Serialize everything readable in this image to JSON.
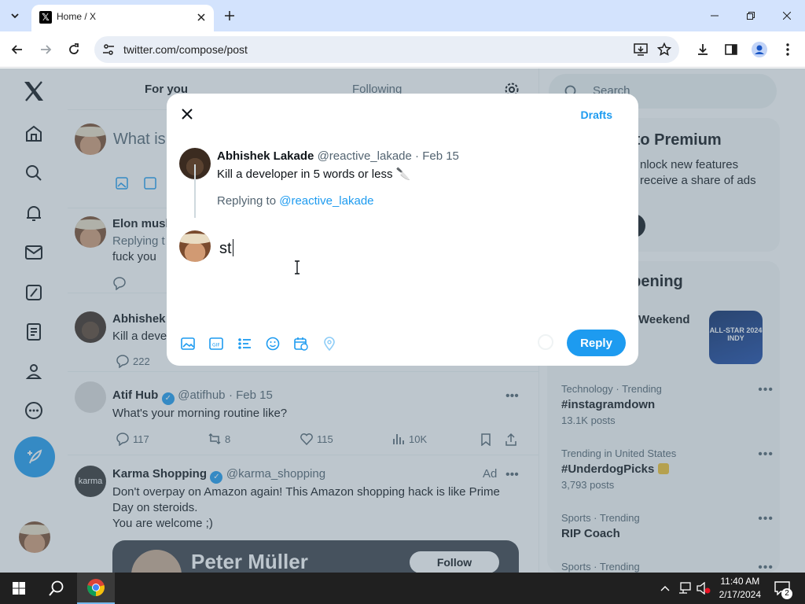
{
  "browser": {
    "tab_title": "Home / X",
    "url": "twitter.com/compose/post"
  },
  "timeline": {
    "tabs": [
      "For you",
      "Following"
    ],
    "composer_placeholder": "What is",
    "posts": [
      {
        "name": "Elon musk",
        "text_line1": "Replying t",
        "text_line2": "fuck you"
      },
      {
        "name": "Abhishek",
        "text": "Kill a deve",
        "replies": "222"
      },
      {
        "name": "Atif Hub",
        "handle": "@atifhub",
        "date": "· Feb 15",
        "text": "What's your morning routine like?",
        "replies": "117",
        "reposts": "8",
        "likes": "115",
        "views": "10K"
      },
      {
        "name": "Karma Shopping",
        "handle": "@karma_shopping",
        "ad": "Ad",
        "text_line1": "Don't overpay on Amazon again! This Amazon shopping hack is like Prime",
        "text_line2": "Day on steroids.",
        "text_line3": "You are welcome ;)",
        "card_name": "Peter Müller",
        "card_button": "Follow",
        "avatar_text": "karma"
      }
    ]
  },
  "sidebar": {
    "search_placeholder": "Search",
    "premium_title": "e to Premium",
    "premium_line1": "nlock new features",
    "premium_line2": "receive a share of ads",
    "happening_title": "ppening",
    "event_title": "Weekend",
    "event_image_text": "ALL-STAR 2024 INDY",
    "trends": [
      {
        "category": "Technology · Trending",
        "title": "#instagramdown",
        "count": "13.1K posts"
      },
      {
        "category": "Trending in United States",
        "title": "#UnderdogPicks",
        "count": "3,793 posts"
      },
      {
        "category": "Sports · Trending",
        "title": "RIP Coach",
        "count": ""
      },
      {
        "category": "Sports · Trending",
        "title": "",
        "count": ""
      }
    ]
  },
  "modal": {
    "drafts": "Drafts",
    "reply_to_name": "Abhishek Lakade",
    "reply_to_handle": "@reactive_lakade",
    "reply_to_date": "· Feb 15",
    "reply_to_text": "Kill a developer in 5 words or less 🔪",
    "replying_prefix": "Replying to",
    "replying_handle": "@reactive_lakade",
    "typed_text": "st",
    "reply_button": "Reply"
  },
  "taskbar": {
    "time": "11:40 AM",
    "date": "2/17/2024",
    "notification_count": "2"
  },
  "colors": {
    "accent": "#1d9bf0",
    "chrome_frame": "#d3e3fd",
    "taskbar": "#202020"
  }
}
